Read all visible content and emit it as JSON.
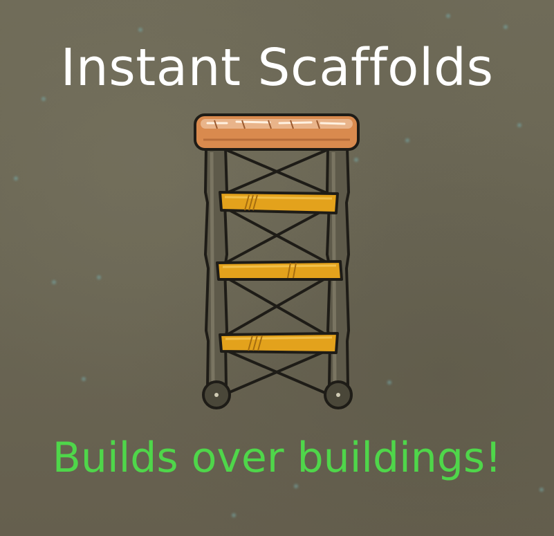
{
  "title": "Instant Scaffolds",
  "subtitle": "Builds over buildings!",
  "colors": {
    "background": "#6e6a57",
    "title_text": "#ffffff",
    "subtitle_text": "#4fd64a",
    "plank_wood": "#d98a4e",
    "beam_wood": "#e3a21c",
    "pole": "#5a5646",
    "outline": "#1e1c17"
  },
  "icon": "scaffold-icon"
}
